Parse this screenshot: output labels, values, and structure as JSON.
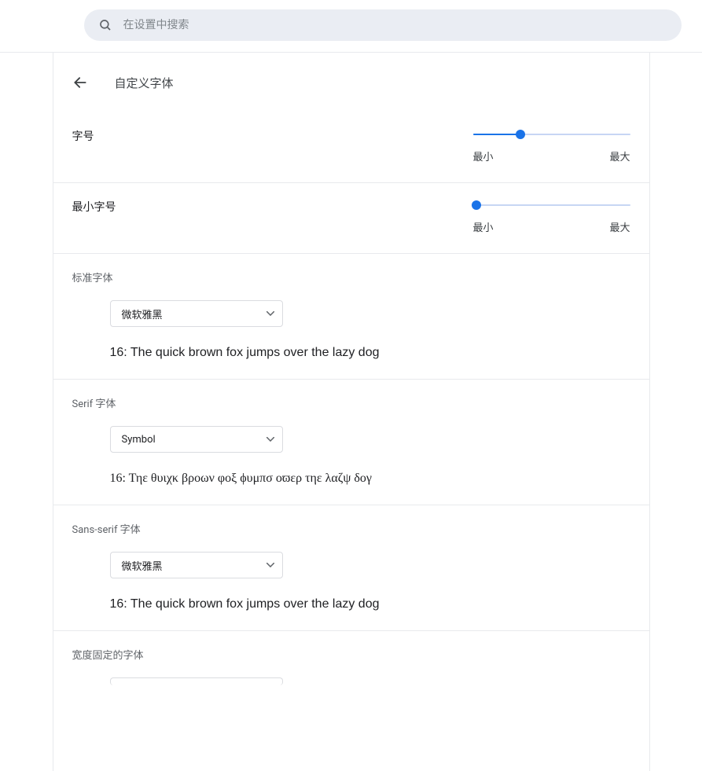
{
  "search": {
    "placeholder": "在设置中搜索"
  },
  "header": {
    "title": "自定义字体"
  },
  "sliders": {
    "fontSize": {
      "label": "字号",
      "minLabel": "最小",
      "maxLabel": "最大",
      "percent": 30
    },
    "minFontSize": {
      "label": "最小字号",
      "minLabel": "最小",
      "maxLabel": "最大",
      "percent": 2
    }
  },
  "fonts": {
    "standard": {
      "label": "标准字体",
      "selected": "微软雅黑",
      "preview": "16: The quick brown fox jumps over the lazy dog"
    },
    "serif": {
      "label": "Serif 字体",
      "selected": "Symbol",
      "preview": "16: Τηε θυιχκ βροων φοξ ϕυμπσ οϖερ τηε λαζψ δογ"
    },
    "sans": {
      "label": "Sans-serif 字体",
      "selected": "微软雅黑",
      "preview": "16: The quick brown fox jumps over the lazy dog"
    },
    "fixed": {
      "label": "宽度固定的字体"
    }
  }
}
